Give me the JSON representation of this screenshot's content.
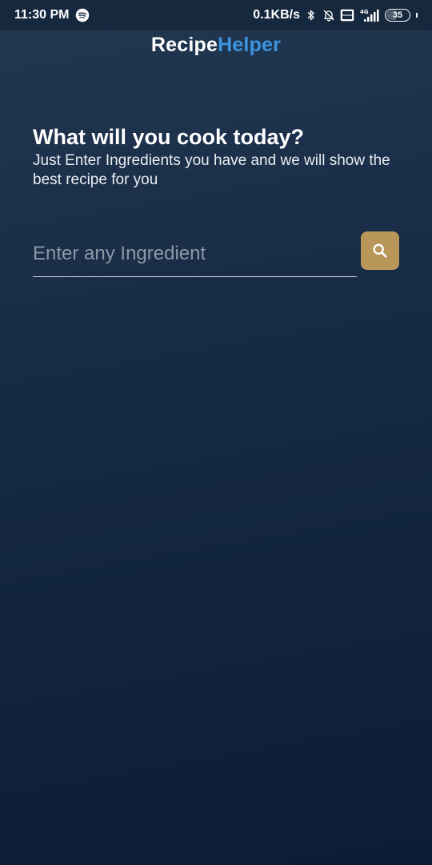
{
  "status_bar": {
    "time": "11:30 PM",
    "network_speed": "0.1KB/s",
    "network_type": "4G",
    "battery": "35",
    "icons": [
      "spotify-icon",
      "bluetooth-icon",
      "bell-off-icon",
      "volte-icon",
      "signal-icon",
      "battery-icon"
    ]
  },
  "app": {
    "title_part1": "Recipe",
    "title_part2": "Helper",
    "accent_color": "#3c95e0"
  },
  "main": {
    "heading": "What will you cook today?",
    "subtitle": "Just Enter Ingredients you have and we will show the best recipe for you"
  },
  "search": {
    "placeholder": "Enter any Ingredient",
    "value": "",
    "button_color": "#b99659",
    "button_icon": "search-icon"
  }
}
